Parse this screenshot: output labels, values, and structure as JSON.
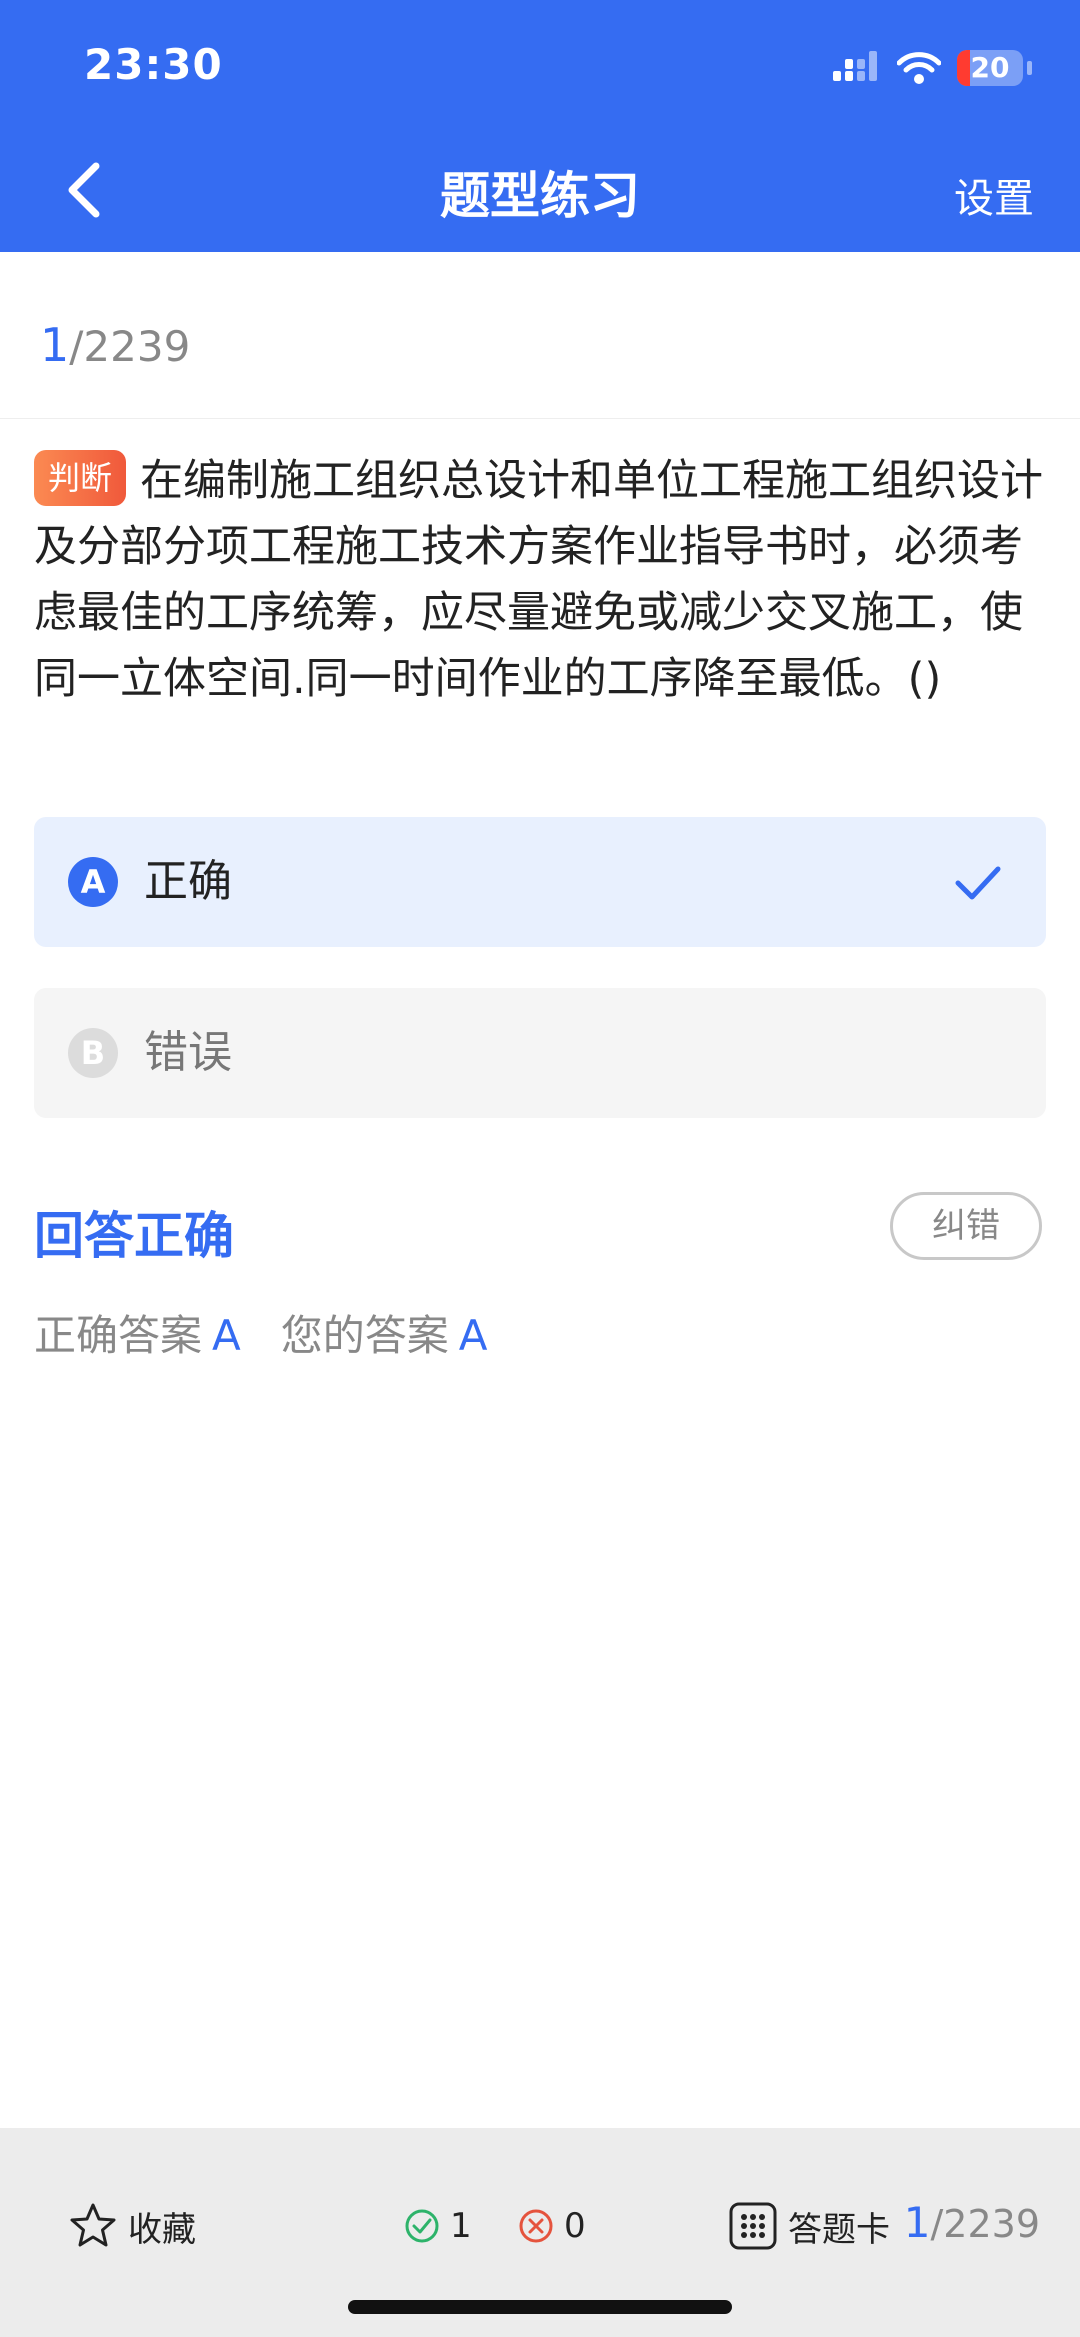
{
  "status_bar": {
    "time": "23:30",
    "battery": "20",
    "battery_level": 0.2
  },
  "nav": {
    "title": "题型练习",
    "settings_label": "设置"
  },
  "progress": {
    "current": "1",
    "total": "/2239"
  },
  "question": {
    "type_tag": "判断",
    "text": "在编制施工组织总设计和单位工程施工组织设计及分部分项工程施工技术方案作业指导书时，必须考虑最佳的工序统筹，应尽量避免或减少交叉施工，使同一立体空间.同一时间作业的工序降至最低。()"
  },
  "options": [
    {
      "letter": "A",
      "text": "正确",
      "selected": true
    },
    {
      "letter": "B",
      "text": "错误",
      "selected": false
    }
  ],
  "result": {
    "title": "回答正确",
    "report_label": "纠错",
    "correct_label": "正确答案",
    "correct_value": "A",
    "yours_label": "您的答案",
    "yours_value": "A"
  },
  "bottom_bar": {
    "favorite_label": "收藏",
    "right_count": "1",
    "wrong_count": "0",
    "answer_card_label": "答题卡",
    "progress_current": "1",
    "progress_total": "/2239"
  },
  "colors": {
    "primary": "#356cf2",
    "tag": "#f0593b",
    "right": "#2db36a",
    "wrong": "#e5533d"
  }
}
